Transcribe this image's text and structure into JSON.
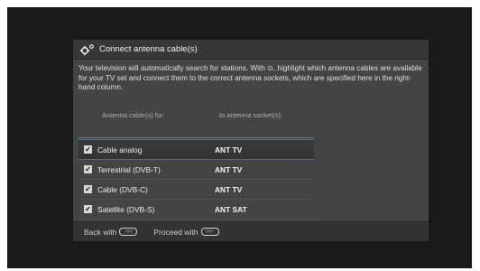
{
  "dialog": {
    "title": "Connect antenna cable(s)",
    "description": "Your television will automatically search for stations. With ⊙, highlight which antenna cables are available for your TV set and connect them to the correct antenna sockets, which are specified here in the right-hand column.",
    "header": {
      "col1": "Antenna cable(s) for:",
      "col2": "to antenna socket(s):"
    },
    "rows": [
      {
        "name": "Cable analog",
        "socket": "ANT TV",
        "checked": true
      },
      {
        "name": "Terrestrial (DVB-T)",
        "socket": "ANT TV",
        "checked": true
      },
      {
        "name": "Cable (DVB-C)",
        "socket": "ANT TV",
        "checked": true
      },
      {
        "name": "Satellite (DVB-S)",
        "socket": "ANT SAT",
        "checked": true
      }
    ],
    "footer": {
      "back_label": "Back with",
      "back_key": "◁◁",
      "proceed_label": "Proceed with",
      "proceed_key": "▷▷"
    }
  },
  "icons": {
    "title_icon": "settings-gear-icon",
    "check_mark": "✔"
  }
}
